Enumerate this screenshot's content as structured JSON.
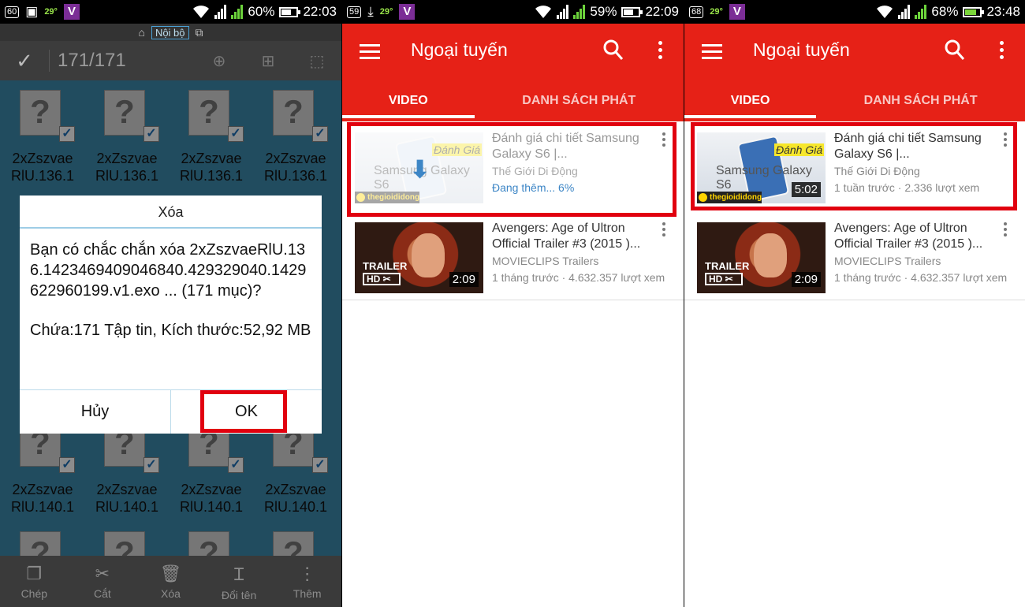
{
  "panel1": {
    "status": {
      "notif": "60",
      "temp": "29°",
      "carrier": "V",
      "sim2": "2",
      "battery": "60%",
      "battery_level": 0.6,
      "time": "22:03"
    },
    "location": {
      "home_icon": "home-icon",
      "chip": "Nội bộ"
    },
    "toolbar": {
      "count": "171/171"
    },
    "tiles": [
      {
        "line1": "2xZszvae",
        "line2": "RlU.136.1"
      },
      {
        "line1": "2xZszvae",
        "line2": "RlU.136.1"
      },
      {
        "line1": "2xZszvae",
        "line2": "RlU.136.1"
      },
      {
        "line1": "2xZszvae",
        "line2": "RlU.136.1"
      },
      {
        "line1": "2xZszvae",
        "line2": "RlU.140.1"
      },
      {
        "line1": "2xZszvae",
        "line2": "RlU.140.1"
      },
      {
        "line1": "2xZszvae",
        "line2": "RlU.140.1"
      },
      {
        "line1": "2xZszvae",
        "line2": "RlU.140.1"
      }
    ],
    "dialog": {
      "title": "Xóa",
      "message": "Bạn có chắc chắn xóa 2xZszvaeRlU.136.1423469409046840.429329040.1429622960199.v1.exo ... (171 mục)?",
      "details": "Chứa:171 Tập tin, Kích thước:52,92 MB",
      "cancel": "Hủy",
      "ok": "OK"
    },
    "bottom": [
      {
        "label": "Chép",
        "icon": "copy-icon"
      },
      {
        "label": "Cắt",
        "icon": "scissors-icon"
      },
      {
        "label": "Xóa",
        "icon": "trash-icon"
      },
      {
        "label": "Đổi tên",
        "icon": "rename-icon"
      },
      {
        "label": "Thêm",
        "icon": "more-icon"
      }
    ]
  },
  "panel2": {
    "status": {
      "notif": "59",
      "temp": "29°",
      "carrier": "V",
      "sim2": "2",
      "battery": "59%",
      "battery_level": 0.59,
      "time": "22:09"
    },
    "title": "Ngoại tuyến",
    "tabs": [
      "VIDEO",
      "DANH SÁCH PHÁT"
    ],
    "videos": [
      {
        "title": "Đánh giá chi tiết Samsung Galaxy S6 |...",
        "channel": "Thế Giới Di Động",
        "stat": "Đang thêm... 6%"
      },
      {
        "title": "Avengers: Age of Ultron Official Trailer #3 (2015 )...",
        "channel": "MOVIECLIPS Trailers",
        "stat": "1 tháng trước · 4.632.357 lượt xem",
        "duration": "2:09"
      }
    ]
  },
  "panel3": {
    "status": {
      "notif": "68",
      "temp": "29°",
      "carrier": "V",
      "sim2": "2",
      "battery": "68%",
      "battery_level": 0.68,
      "time": "23:48"
    },
    "title": "Ngoại tuyến",
    "tabs": [
      "VIDEO",
      "DANH SÁCH PHÁT"
    ],
    "videos": [
      {
        "title": "Đánh giá chi tiết Samsung Galaxy S6 |...",
        "channel": "Thế Giới Di Động",
        "stat": "1 tuần trước · 2.336 lượt xem",
        "duration": "5:02"
      },
      {
        "title": "Avengers: Age of Ultron Official Trailer #3 (2015 )...",
        "channel": "MOVIECLIPS Trailers",
        "stat": "1 tháng trước · 4.632.357 lượt xem",
        "duration": "2:09"
      }
    ]
  },
  "thumb_text": {
    "danh_gia": "Đánh Giá",
    "samsung": "Samsung Galaxy S6",
    "brand": "thegioididong",
    "trailer": "TRAILER",
    "hd": "HD ✂"
  },
  "colors": {
    "youtube_red": "#e62117",
    "highlight_red": "#e1000f",
    "grid_blue": "#3d8aad",
    "progress_blue": "#3d86c6"
  }
}
